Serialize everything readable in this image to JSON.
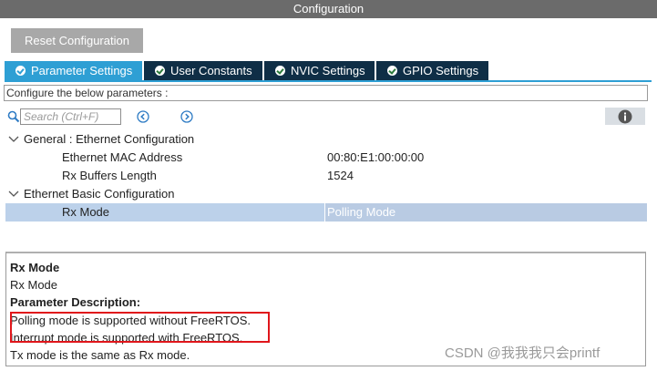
{
  "window": {
    "title": "Configuration"
  },
  "toolbar": {
    "reset_label": "Reset Configuration"
  },
  "tabs": [
    {
      "label": "Parameter Settings",
      "active": true
    },
    {
      "label": "User Constants",
      "active": false
    },
    {
      "label": "NVIC Settings",
      "active": false
    },
    {
      "label": "GPIO Settings",
      "active": false
    }
  ],
  "configure_label": "Configure the below parameters :",
  "search": {
    "placeholder": "Search (Ctrl+F)"
  },
  "tree": {
    "group1": {
      "label": "General : Ethernet Configuration",
      "items": [
        {
          "label": "Ethernet MAC Address",
          "value": "00:80:E1:00:00:00"
        },
        {
          "label": "Rx Buffers Length",
          "value": "1524"
        }
      ]
    },
    "group2": {
      "label": "Ethernet Basic Configuration",
      "items": [
        {
          "label": "Rx Mode",
          "value": "Polling Mode",
          "selected": true
        }
      ]
    }
  },
  "description": {
    "title": "Rx Mode",
    "name": "Rx Mode",
    "heading": "Parameter Description:",
    "lines": [
      "Polling mode is supported without FreeRTOS.",
      "Interrupt mode is supported with FreeRTOS.",
      "Tx mode is the same as Rx mode."
    ]
  },
  "watermark": "CSDN @我我我只会printf",
  "colors": {
    "active_tab": "#2e9fd4",
    "inactive_tab": "#0f2e46",
    "selected_row": "#bcd1ea",
    "highlight_box": "#e0161b"
  }
}
